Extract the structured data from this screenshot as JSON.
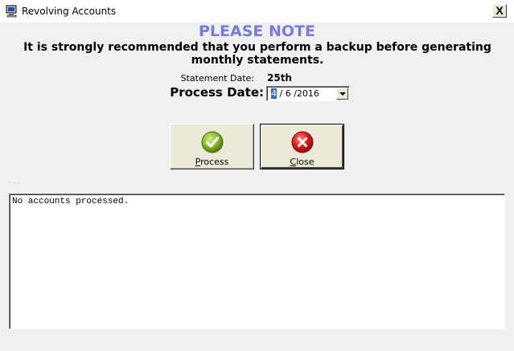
{
  "window": {
    "title": "Revolving Accounts",
    "close_glyph": "X"
  },
  "notice": {
    "heading": "PLEASE NOTE",
    "message": "It is strongly recommended that you perform a backup before generating monthly statements.",
    "heading_color": "#7b7bd6"
  },
  "statement_date": {
    "label": "Statement Date:",
    "value": "25th"
  },
  "process_date": {
    "label": "Process Date:",
    "month": "4",
    "rest": " / 6 /2016"
  },
  "buttons": {
    "process": {
      "label_underlined": "P",
      "label_rest": "rocess",
      "icon": "checkmark-icon",
      "color": "#7aa02c"
    },
    "close": {
      "label_underlined": "C",
      "label_rest": "lose",
      "icon": "close-icon",
      "color": "#e02020"
    }
  },
  "log": {
    "text": "No accounts processed."
  }
}
